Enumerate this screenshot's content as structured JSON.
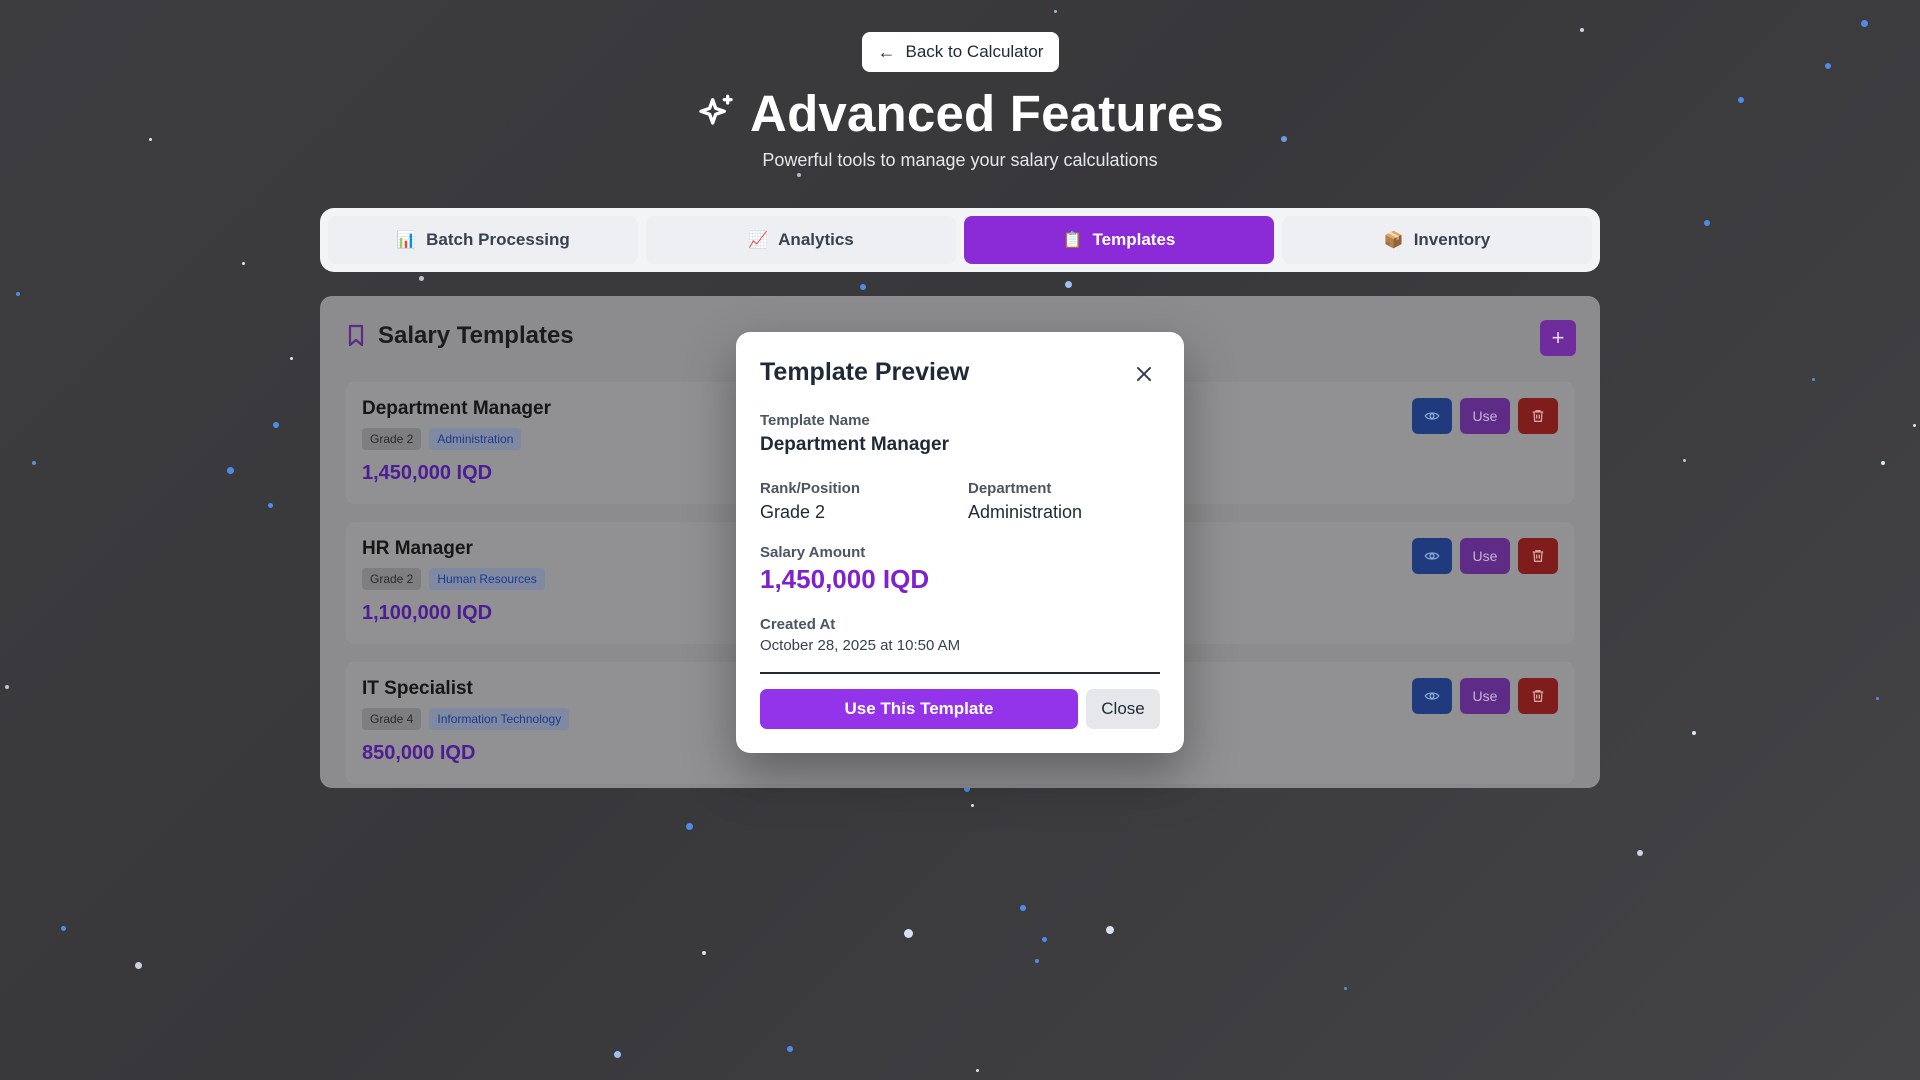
{
  "header": {
    "back_label": "Back to Calculator",
    "title": "Advanced Features",
    "subtitle": "Powerful tools to manage your salary calculations"
  },
  "tabs": [
    {
      "label": "Batch Processing",
      "icon": "📊",
      "active": false
    },
    {
      "label": "Analytics",
      "icon": "📈",
      "active": false
    },
    {
      "label": "Templates",
      "icon": "📋",
      "active": true
    },
    {
      "label": "Inventory",
      "icon": "📦",
      "active": false
    }
  ],
  "panel": {
    "title": "Salary Templates",
    "add_icon": "+",
    "use_label": "Use",
    "templates": [
      {
        "name": "Department Manager",
        "rank": "Grade 2",
        "department": "Administration",
        "amount": "1,450,000 IQD"
      },
      {
        "name": "HR Manager",
        "rank": "Grade 2",
        "department": "Human Resources",
        "amount": "1,100,000 IQD"
      },
      {
        "name": "IT Specialist",
        "rank": "Grade 4",
        "department": "Information Technology",
        "amount": "850,000 IQD"
      }
    ]
  },
  "modal": {
    "title": "Template Preview",
    "name_label": "Template Name",
    "name_value": "Department Manager",
    "rank_label": "Rank/Position",
    "rank_value": "Grade 2",
    "dept_label": "Department",
    "dept_value": "Administration",
    "salary_label": "Salary Amount",
    "salary_value": "1,450,000 IQD",
    "created_label": "Created At",
    "created_value": "October 28, 2025 at 10:50 AM",
    "use_button": "Use This Template",
    "close_button": "Close"
  },
  "colors": {
    "accent": "#9333ea",
    "active_tab": "#8b2bd8",
    "view_button": "#1f3a7d",
    "delete_button": "#7f1d1d",
    "background": "#3b3b3e"
  }
}
